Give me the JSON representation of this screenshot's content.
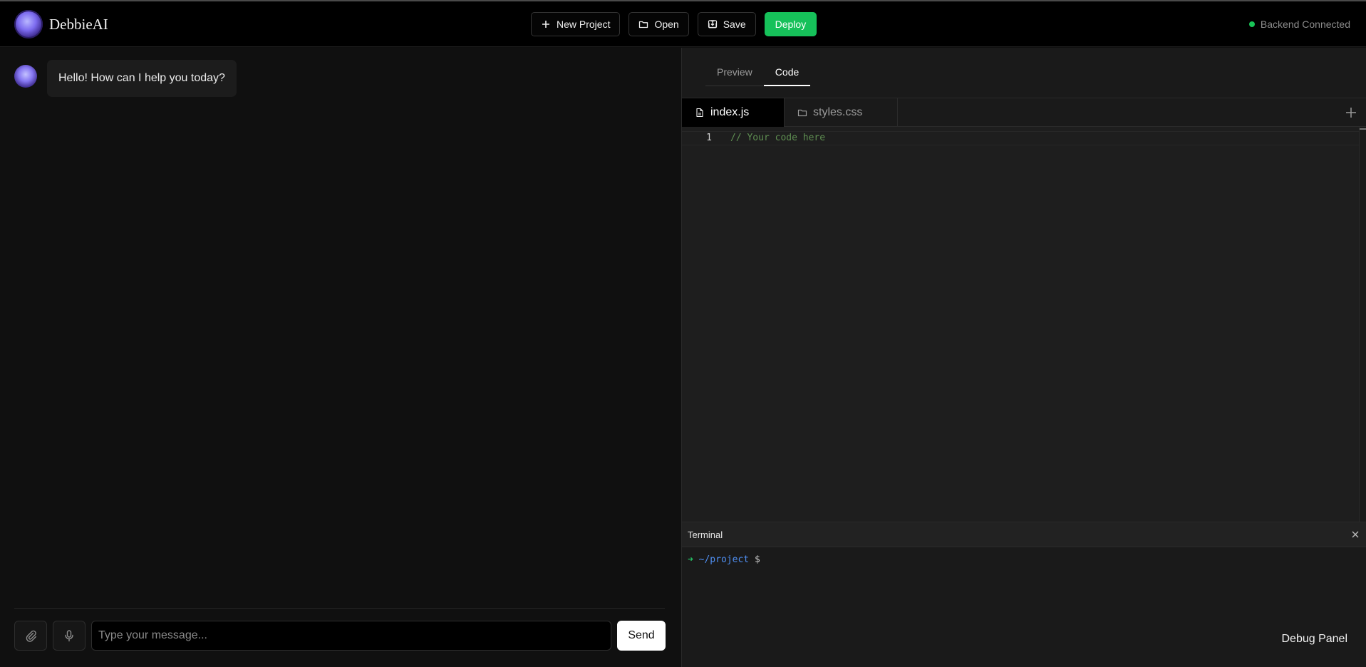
{
  "app": {
    "name": "DebbieAI"
  },
  "header": {
    "buttons": [
      {
        "label": "New Project",
        "icon": "plus-icon"
      },
      {
        "label": "Open",
        "icon": "folder-icon"
      },
      {
        "label": "Save",
        "icon": "save-icon"
      },
      {
        "label": "Deploy"
      }
    ],
    "status": {
      "text": "Backend Connected",
      "color": "#18c457"
    }
  },
  "chat": {
    "messages": [
      {
        "role": "assistant",
        "text": "Hello! How can I help you today?"
      }
    ],
    "composer": {
      "placeholder": "Type your message...",
      "value": "",
      "send_label": "Send",
      "attach_icon": "paperclip-icon",
      "mic_icon": "microphone-icon"
    }
  },
  "editor": {
    "view_tabs": [
      {
        "label": "Preview",
        "active": false
      },
      {
        "label": "Code",
        "active": true
      }
    ],
    "file_tabs": [
      {
        "label": "index.js",
        "icon": "file-icon",
        "active": true
      },
      {
        "label": "styles.css",
        "icon": "folder-icon",
        "active": false
      }
    ],
    "add_file_icon": "plus-icon",
    "code_lines": [
      {
        "number": "1",
        "text": "// Your code here"
      }
    ]
  },
  "terminal": {
    "title": "Terminal",
    "prompt_arrow": "➜",
    "prompt_path": "~/project",
    "prompt_symbol": "$"
  },
  "debug": {
    "label": "Debug Panel"
  },
  "colors": {
    "accent_green": "#16c15a",
    "background": "#0f0f0f",
    "comment_green": "#5f8f52",
    "path_blue": "#4f8ef0"
  }
}
